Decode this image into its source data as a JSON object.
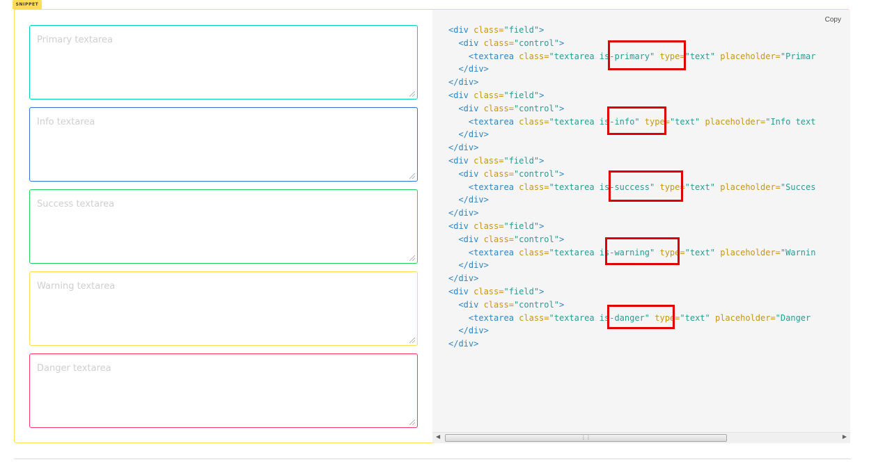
{
  "snippet": {
    "tag_label": "SNIPPET",
    "copy_label": "Copy"
  },
  "preview": {
    "textareas": [
      {
        "placeholder": "Primary textarea",
        "border_color": "#00d1b2"
      },
      {
        "placeholder": "Info textarea",
        "border_color": "#3273dc"
      },
      {
        "placeholder": "Success textarea",
        "border_color": "#23d160"
      },
      {
        "placeholder": "Warning textarea",
        "border_color": "#ffdd57"
      },
      {
        "placeholder": "Danger textarea",
        "border_color": "#ff3860"
      }
    ]
  },
  "code": {
    "blocks": [
      {
        "modifier": "is-primary",
        "placeholder_fragment": "Primar"
      },
      {
        "modifier": "is-info",
        "placeholder_fragment": "Info text"
      },
      {
        "modifier": "is-success",
        "placeholder_fragment": "Succes"
      },
      {
        "modifier": "is-warning",
        "placeholder_fragment": "Warnin"
      },
      {
        "modifier": "is-danger",
        "placeholder_fragment": "Danger"
      }
    ],
    "highlight_color": "#e00000"
  }
}
